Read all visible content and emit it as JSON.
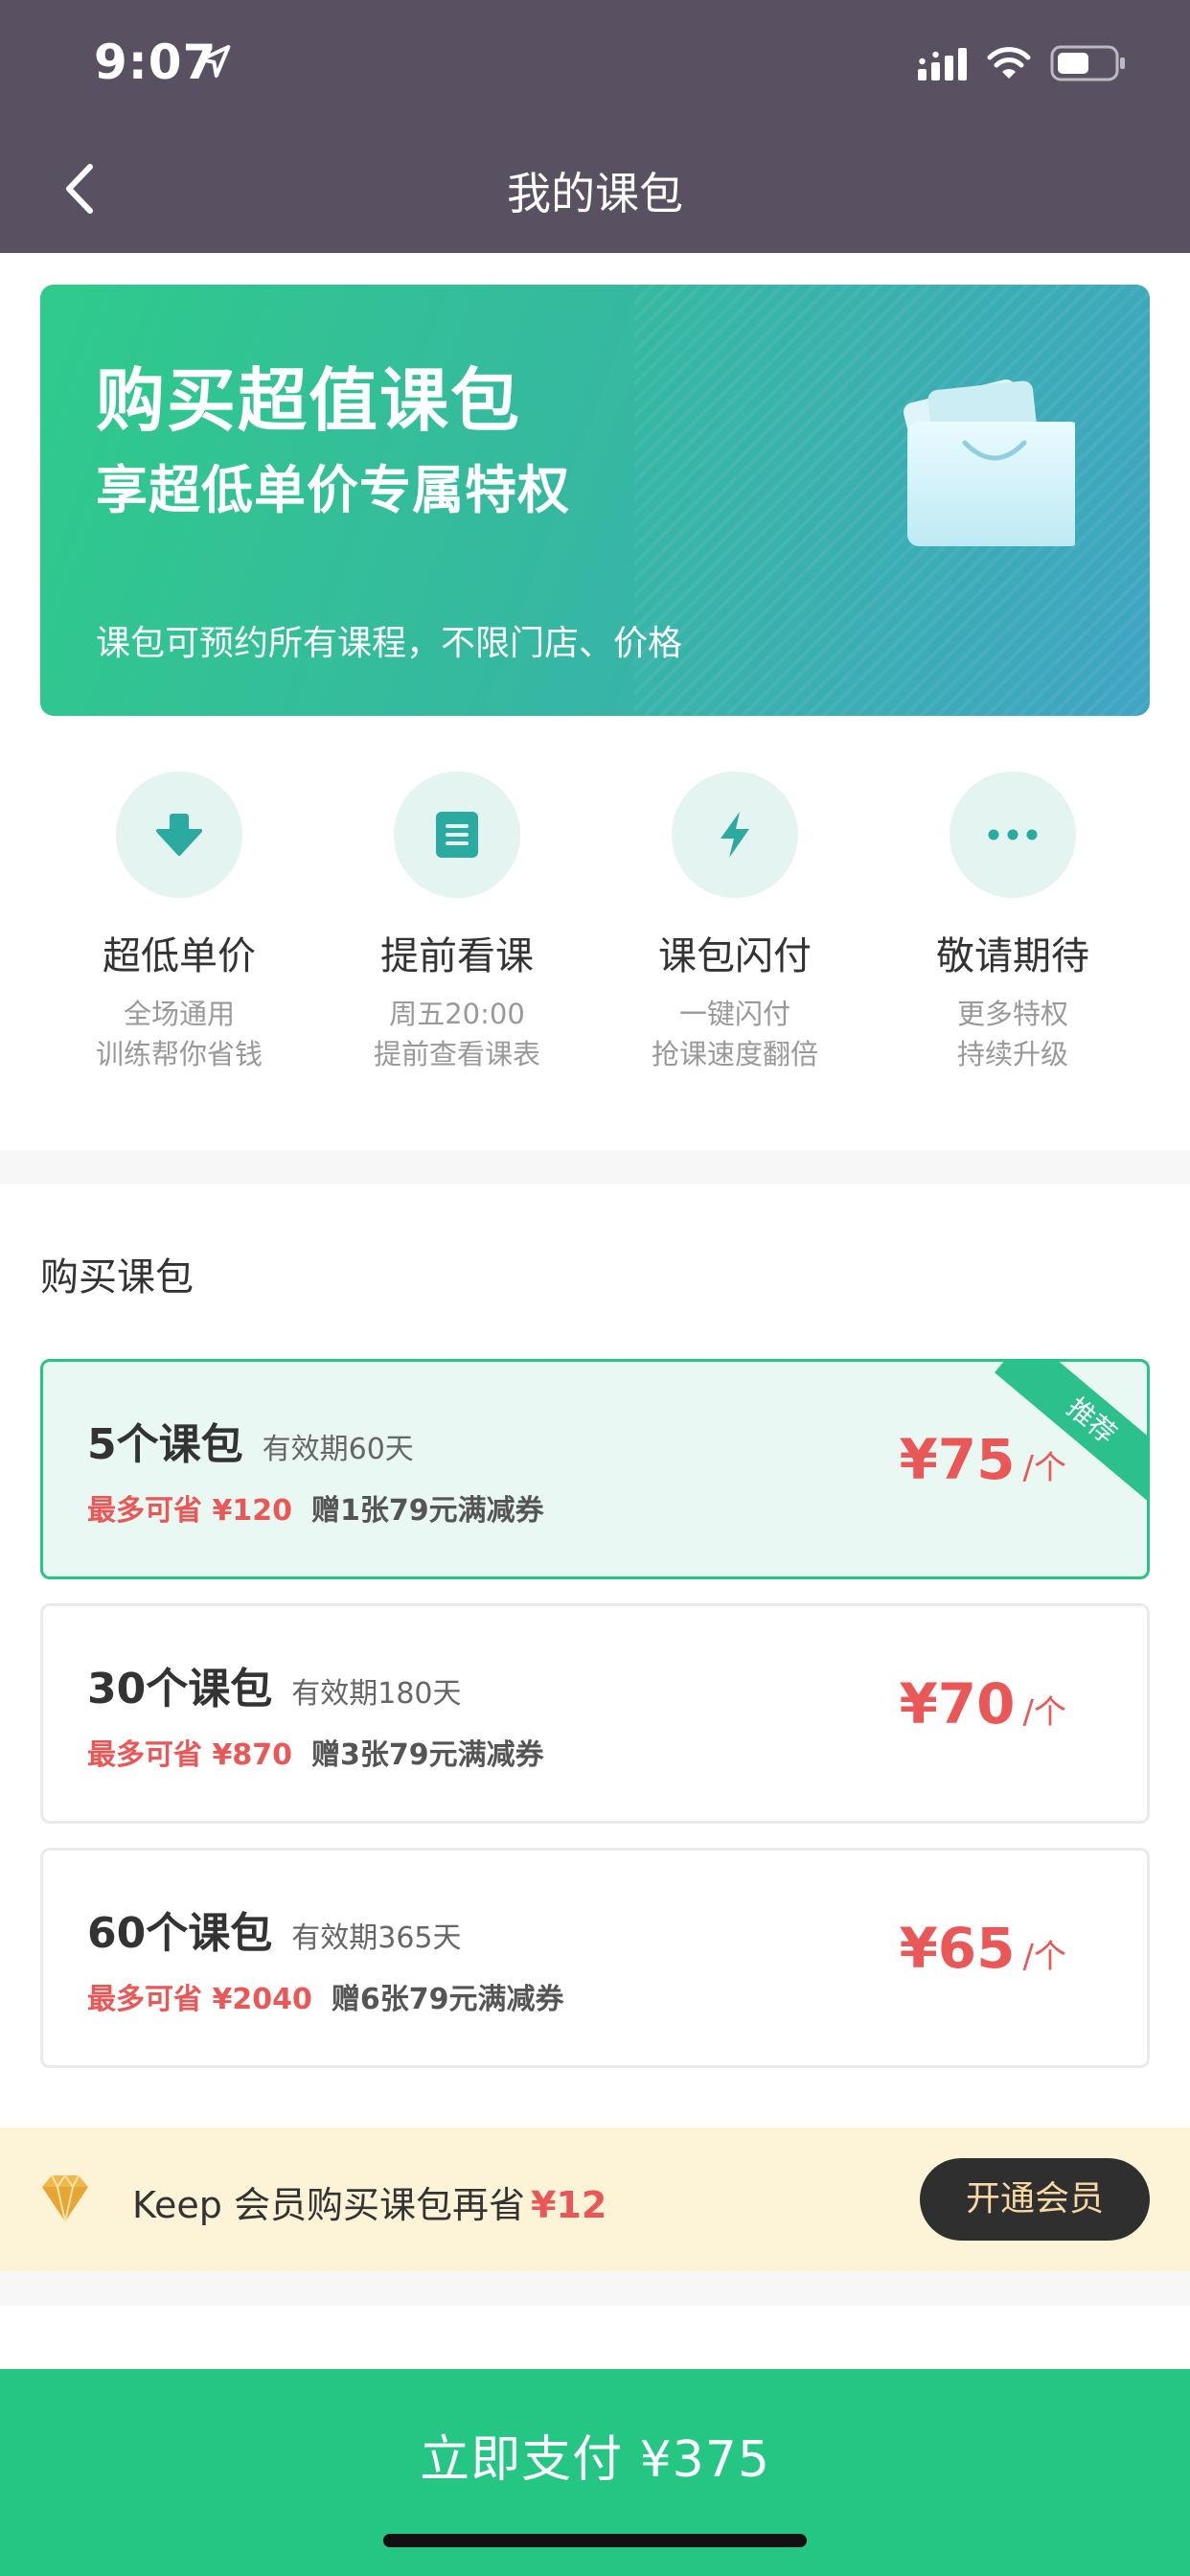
{
  "status_bar": {
    "time": "9:07"
  },
  "nav": {
    "title": "我的课包"
  },
  "banner": {
    "title": "购买超值课包",
    "subtitle": "享超低单价专属特权",
    "note": "课包可预约所有课程，不限门店、价格"
  },
  "features": [
    {
      "title": "超低单价",
      "desc1": "全场通用",
      "desc2": "训练帮你省钱",
      "icon": "download-arrow-icon"
    },
    {
      "title": "提前看课",
      "desc1": "周五20:00",
      "desc2": "提前查看课表",
      "icon": "document-icon"
    },
    {
      "title": "课包闪付",
      "desc1": "一键闪付",
      "desc2": "抢课速度翻倍",
      "icon": "lightning-icon"
    },
    {
      "title": "敬请期待",
      "desc1": "更多特权",
      "desc2": "持续升级",
      "icon": "more-dots-icon"
    }
  ],
  "section": {
    "title": "购买课包"
  },
  "packs": [
    {
      "name": "5个课包",
      "valid": "有效期60天",
      "save": "最多可省 ¥120",
      "gift": "赠1张79元满减券",
      "price": "¥75",
      "unit": "/个",
      "ribbon": "推荐",
      "selected": true
    },
    {
      "name": "30个课包",
      "valid": "有效期180天",
      "save": "最多可省 ¥870",
      "gift": "赠3张79元满减券",
      "price": "¥70",
      "unit": "/个",
      "selected": false
    },
    {
      "name": "60个课包",
      "valid": "有效期365天",
      "save": "最多可省 ¥2040",
      "gift": "赠6张79元满减券",
      "price": "¥65",
      "unit": "/个",
      "selected": false
    }
  ],
  "member": {
    "text": "Keep 会员购买课包再省",
    "highlight": "¥12",
    "button": "开通会员"
  },
  "pay": {
    "label": "立即支付 ¥375"
  },
  "colors": {
    "header": "#595162",
    "accent_green": "#25c584",
    "price_red": "#ea5757",
    "member_bg": "#fdf3d6"
  }
}
